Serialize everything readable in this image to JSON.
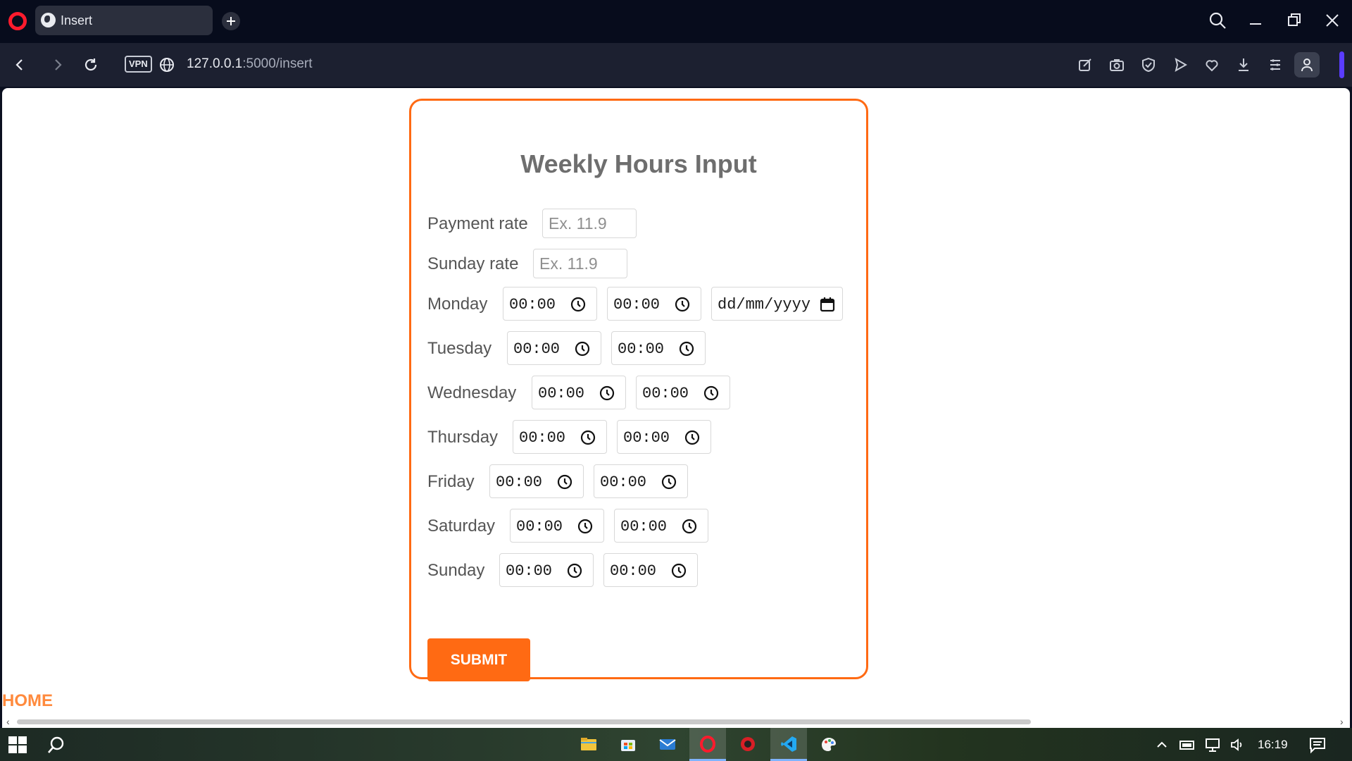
{
  "browser": {
    "tab_title": "Insert",
    "vpn_label": "VPN",
    "url_host": "127.0.0.1",
    "url_rest": ":5000/insert"
  },
  "form": {
    "title": "Weekly Hours Input",
    "payment_rate": {
      "label": "Payment rate",
      "placeholder": "Ex. 11.9"
    },
    "sunday_rate": {
      "label": "Sunday rate",
      "placeholder": "Ex. 11.9"
    },
    "days": [
      {
        "label": "Monday",
        "start": "00:00",
        "end": "00:00",
        "date": "dd/mm/yyyy"
      },
      {
        "label": "Tuesday",
        "start": "00:00",
        "end": "00:00"
      },
      {
        "label": "Wednesday",
        "start": "00:00",
        "end": "00:00"
      },
      {
        "label": "Thursday",
        "start": "00:00",
        "end": "00:00"
      },
      {
        "label": "Friday",
        "start": "00:00",
        "end": "00:00"
      },
      {
        "label": "Saturday",
        "start": "00:00",
        "end": "00:00"
      },
      {
        "label": "Sunday",
        "start": "00:00",
        "end": "00:00"
      }
    ],
    "submit_label": "SUBMIT"
  },
  "home_link": "HOME",
  "taskbar": {
    "time": "16:19"
  },
  "colors": {
    "accent": "#ff6a13",
    "home_link": "#ff8a3d",
    "title": "#6e6e6e"
  },
  "icons": {
    "browser": [
      "opera-logo-icon",
      "globe-icon",
      "search-icon",
      "minimize-icon",
      "restore-icon",
      "close-icon"
    ],
    "toolbar": [
      "back-icon",
      "forward-icon",
      "reload-icon",
      "edit-icon",
      "camera-icon",
      "shield-icon",
      "send-icon",
      "heart-icon",
      "download-icon",
      "menu-icon",
      "profile-icon"
    ],
    "taskbar": [
      "windows-start-icon",
      "search-icon",
      "file-explorer-icon",
      "store-icon",
      "mail-icon",
      "opera-icon",
      "app-icon",
      "vscode-icon",
      "paint-icon",
      "chevron-up-icon",
      "battery-icon",
      "network-icon",
      "volume-icon",
      "notification-icon"
    ]
  }
}
